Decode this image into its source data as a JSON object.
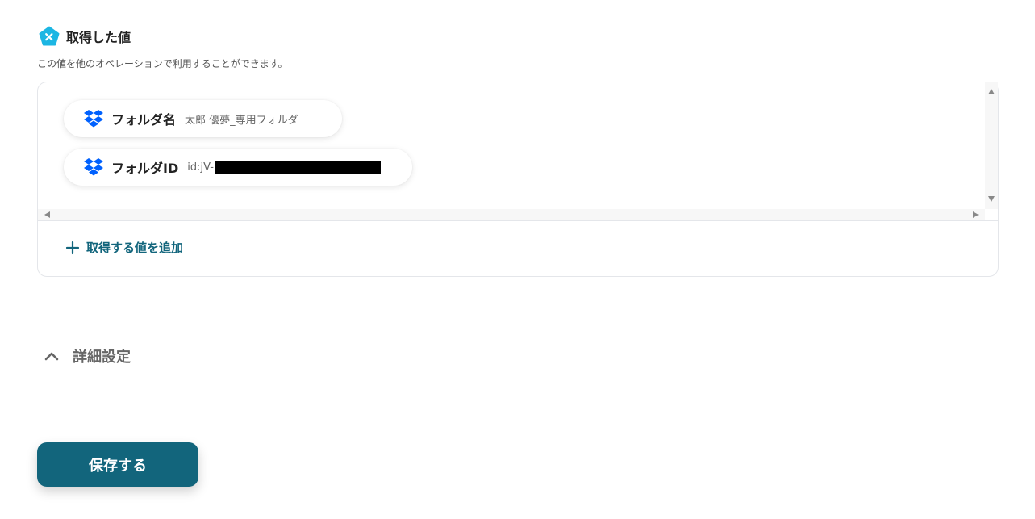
{
  "header": {
    "icon": "yoom-pentagon-icon",
    "title": "取得した値",
    "subtitle": "この値を他のオペレーションで利用することができます。"
  },
  "fields": [
    {
      "icon": "dropbox-icon",
      "name": "フォルダ名",
      "value": "太郎 優夢_専用フォルダ"
    },
    {
      "icon": "dropbox-icon",
      "name": "フォルダID",
      "value": "id:jV-",
      "redacted": true
    }
  ],
  "add_value_label": "取得する値を追加",
  "advanced_label": "詳細設定",
  "save_label": "保存する",
  "colors": {
    "accent": "#12657c",
    "badge": "#1cb6e3",
    "dropbox": "#0061fe"
  }
}
